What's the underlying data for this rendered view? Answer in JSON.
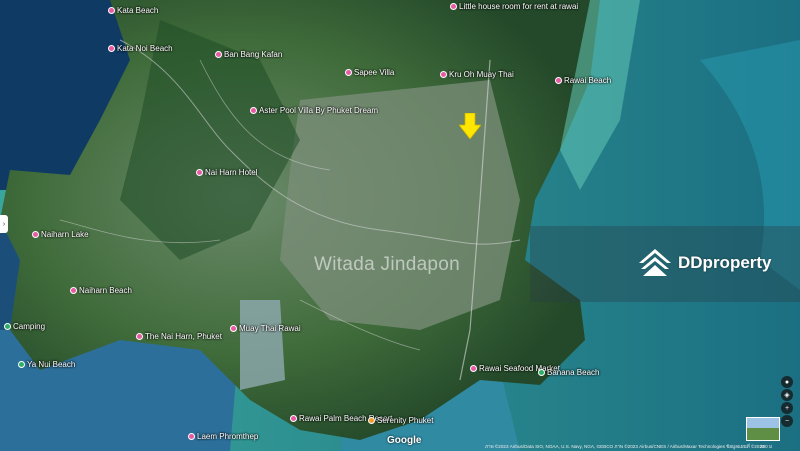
{
  "map": {
    "watermark": "Witada Jindapon",
    "brand": "DDproperty",
    "google": "Google",
    "attribution": "ภาพ ©2023 Airbus/Data SIO, NOAA, U.S. Navy, NGA, GEBCO ภาพ ©2023 Airbus/CNES / Airbus/Maxar Technologies ข้อมูลแผนที่ ©2023",
    "scale": "200 ม",
    "pois": [
      {
        "label": "Little house room for rent at rawai"
      },
      {
        "label": "Kata Beach"
      },
      {
        "label": "Kata Noi Beach"
      },
      {
        "label": "Ban Bang Kafan"
      },
      {
        "label": "Sapee Villa"
      },
      {
        "label": "Kru Oh Muay Thai"
      },
      {
        "label": "Aster Pool Villa By Phuket Dream"
      },
      {
        "label": "Rawai Beach"
      },
      {
        "label": "Naiharn Beach"
      },
      {
        "label": "The Nai Harn, Phuket"
      },
      {
        "label": "Camping"
      },
      {
        "label": "Rawai Seafood Market"
      },
      {
        "label": "Banana Beach"
      },
      {
        "label": "Muay Thai Rawai"
      },
      {
        "label": "Rawai Palm Beach Resort"
      },
      {
        "label": "Serenity Phuket"
      },
      {
        "label": "Laem Phromthep"
      },
      {
        "label": "Naiharn Lake"
      },
      {
        "label": "Ya Nui Beach"
      },
      {
        "label": "Nai Harn Hotel"
      }
    ],
    "controls": [
      "pegman-icon",
      "compass-icon",
      "zoom-in-icon",
      "zoom-out-icon"
    ]
  }
}
